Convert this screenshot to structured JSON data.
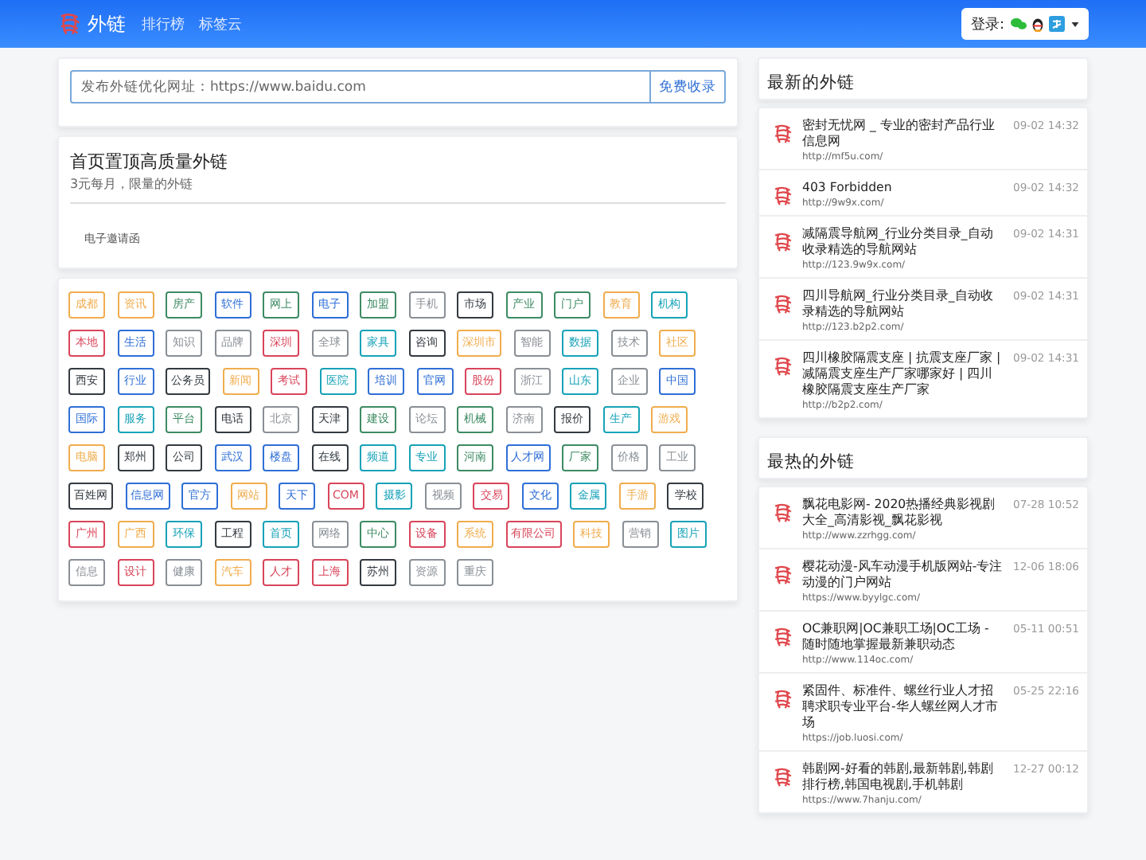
{
  "navbar": {
    "brand": "外链",
    "links": [
      {
        "label": "排行榜"
      },
      {
        "label": "标签云"
      }
    ],
    "login": {
      "label": "登录:"
    }
  },
  "submit": {
    "placeholder": "发布外链优化网址：https://www.baidu.com",
    "button": "免费收录"
  },
  "promo": {
    "title": "首页置顶高质量外链",
    "subtitle": "3元每月，限量的外链",
    "items": [
      "电子邀请函"
    ]
  },
  "tags": [
    {
      "label": "成都",
      "color": "#f0ad4e"
    },
    {
      "label": "资讯",
      "color": "#f0ad4e"
    },
    {
      "label": "房产",
      "color": "#3d8b63"
    },
    {
      "label": "软件",
      "color": "#2f6fd6"
    },
    {
      "label": "网上",
      "color": "#3d8b63"
    },
    {
      "label": "电子",
      "color": "#2f6fd6"
    },
    {
      "label": "加盟",
      "color": "#3d8b63"
    },
    {
      "label": "手机",
      "color": "#8a8f95"
    },
    {
      "label": "市场",
      "color": "#343a40"
    },
    {
      "label": "产业",
      "color": "#3d8b63"
    },
    {
      "label": "门户",
      "color": "#3d8b63"
    },
    {
      "label": "教育",
      "color": "#f0ad4e"
    },
    {
      "label": "机构",
      "color": "#17a2b8"
    },
    {
      "label": "本地",
      "color": "#d9455a"
    },
    {
      "label": "生活",
      "color": "#2f6fd6"
    },
    {
      "label": "知识",
      "color": "#8a8f95"
    },
    {
      "label": "品牌",
      "color": "#8a8f95"
    },
    {
      "label": "深圳",
      "color": "#d9455a"
    },
    {
      "label": "全球",
      "color": "#8a8f95"
    },
    {
      "label": "家具",
      "color": "#17a2b8"
    },
    {
      "label": "咨询",
      "color": "#343a40"
    },
    {
      "label": "深圳市",
      "color": "#f0ad4e"
    },
    {
      "label": "智能",
      "color": "#8a8f95"
    },
    {
      "label": "数据",
      "color": "#17a2b8"
    },
    {
      "label": "技术",
      "color": "#8a8f95"
    },
    {
      "label": "社区",
      "color": "#f0ad4e"
    },
    {
      "label": "西安",
      "color": "#343a40"
    },
    {
      "label": "行业",
      "color": "#2f6fd6"
    },
    {
      "label": "公务员",
      "color": "#343a40"
    },
    {
      "label": "新闻",
      "color": "#f0ad4e"
    },
    {
      "label": "考试",
      "color": "#d9455a"
    },
    {
      "label": "医院",
      "color": "#17a2b8"
    },
    {
      "label": "培训",
      "color": "#2f6fd6"
    },
    {
      "label": "官网",
      "color": "#2f6fd6"
    },
    {
      "label": "股份",
      "color": "#d9455a"
    },
    {
      "label": "浙江",
      "color": "#8a8f95"
    },
    {
      "label": "山东",
      "color": "#17a2b8"
    },
    {
      "label": "企业",
      "color": "#8a8f95"
    },
    {
      "label": "中国",
      "color": "#2f6fd6"
    },
    {
      "label": "国际",
      "color": "#2f6fd6"
    },
    {
      "label": "服务",
      "color": "#17a2b8"
    },
    {
      "label": "平台",
      "color": "#3d8b63"
    },
    {
      "label": "电话",
      "color": "#343a40"
    },
    {
      "label": "北京",
      "color": "#8a8f95"
    },
    {
      "label": "天津",
      "color": "#343a40"
    },
    {
      "label": "建设",
      "color": "#3d8b63"
    },
    {
      "label": "论坛",
      "color": "#8a8f95"
    },
    {
      "label": "机械",
      "color": "#3d8b63"
    },
    {
      "label": "济南",
      "color": "#8a8f95"
    },
    {
      "label": "报价",
      "color": "#343a40"
    },
    {
      "label": "生产",
      "color": "#17a2b8"
    },
    {
      "label": "游戏",
      "color": "#f0ad4e"
    },
    {
      "label": "电脑",
      "color": "#f0ad4e"
    },
    {
      "label": "郑州",
      "color": "#343a40"
    },
    {
      "label": "公司",
      "color": "#343a40"
    },
    {
      "label": "武汉",
      "color": "#2f6fd6"
    },
    {
      "label": "楼盘",
      "color": "#2f6fd6"
    },
    {
      "label": "在线",
      "color": "#343a40"
    },
    {
      "label": "频道",
      "color": "#17a2b8"
    },
    {
      "label": "专业",
      "color": "#17a2b8"
    },
    {
      "label": "河南",
      "color": "#3d8b63"
    },
    {
      "label": "人才网",
      "color": "#2f6fd6"
    },
    {
      "label": "厂家",
      "color": "#3d8b63"
    },
    {
      "label": "价格",
      "color": "#8a8f95"
    },
    {
      "label": "工业",
      "color": "#8a8f95"
    },
    {
      "label": "百姓网",
      "color": "#343a40"
    },
    {
      "label": "信息网",
      "color": "#2f6fd6"
    },
    {
      "label": "官方",
      "color": "#2f6fd6"
    },
    {
      "label": "网站",
      "color": "#f0ad4e"
    },
    {
      "label": "天下",
      "color": "#2f6fd6"
    },
    {
      "label": "COM",
      "color": "#d9455a"
    },
    {
      "label": "摄影",
      "color": "#17a2b8"
    },
    {
      "label": "视频",
      "color": "#8a8f95"
    },
    {
      "label": "交易",
      "color": "#d9455a"
    },
    {
      "label": "文化",
      "color": "#2f6fd6"
    },
    {
      "label": "金属",
      "color": "#17a2b8"
    },
    {
      "label": "手游",
      "color": "#f0ad4e"
    },
    {
      "label": "学校",
      "color": "#343a40"
    },
    {
      "label": "广州",
      "color": "#d9455a"
    },
    {
      "label": "广西",
      "color": "#f0ad4e"
    },
    {
      "label": "环保",
      "color": "#17a2b8"
    },
    {
      "label": "工程",
      "color": "#343a40"
    },
    {
      "label": "首页",
      "color": "#17a2b8"
    },
    {
      "label": "网络",
      "color": "#8a8f95"
    },
    {
      "label": "中心",
      "color": "#3d8b63"
    },
    {
      "label": "设备",
      "color": "#d9455a"
    },
    {
      "label": "系统",
      "color": "#f0ad4e"
    },
    {
      "label": "有限公司",
      "color": "#d9455a"
    },
    {
      "label": "科技",
      "color": "#f0ad4e"
    },
    {
      "label": "营销",
      "color": "#8a8f95"
    },
    {
      "label": "图片",
      "color": "#17a2b8"
    },
    {
      "label": "信息",
      "color": "#8a8f95"
    },
    {
      "label": "设计",
      "color": "#d9455a"
    },
    {
      "label": "健康",
      "color": "#8a8f95"
    },
    {
      "label": "汽车",
      "color": "#f0ad4e"
    },
    {
      "label": "人才",
      "color": "#d9455a"
    },
    {
      "label": "上海",
      "color": "#d9455a"
    },
    {
      "label": "苏州",
      "color": "#343a40"
    },
    {
      "label": "资源",
      "color": "#8a8f95"
    },
    {
      "label": "重庆",
      "color": "#8a8f95"
    }
  ],
  "sections": [
    {
      "title": "最新的外链",
      "items": [
        {
          "title": "密封无忧网 _ 专业的密封产品行业信息网",
          "url": "http://mf5u.com/",
          "time": "09-02 14:32"
        },
        {
          "title": "403 Forbidden",
          "url": "http://9w9x.com/",
          "time": "09-02 14:32"
        },
        {
          "title": "减隔震导航网_行业分类目录_自动收录精选的导航网站",
          "url": "http://123.9w9x.com/",
          "time": "09-02 14:31"
        },
        {
          "title": "四川导航网_行业分类目录_自动收录精选的导航网站",
          "url": "http://123.b2p2.com/",
          "time": "09-02 14:31"
        },
        {
          "title": "四川橡胶隔震支座 | 抗震支座厂家 | 减隔震支座生产厂家哪家好 | 四川橡胶隔震支座生产厂家",
          "url": "http://b2p2.com/",
          "time": "09-02 14:31"
        }
      ]
    },
    {
      "title": "最热的外链",
      "items": [
        {
          "title": "飘花电影网- 2020热播经典影视剧大全_高清影视_飘花影视",
          "url": "http://www.zzrhgg.com/",
          "time": "07-28 10:52"
        },
        {
          "title": "樱花动漫-风车动漫手机版网站-专注动漫的门户网站",
          "url": "https://www.byylgc.com/",
          "time": "12-06 18:06"
        },
        {
          "title": "OC兼职网|OC兼职工场|OC工场 - 随时随地掌握最新兼职动态",
          "url": "http://www.114oc.com/",
          "time": "05-11 00:51"
        },
        {
          "title": "紧固件、标准件、螺丝行业人才招聘求职专业平台-华人螺丝网人才市场",
          "url": "https://job.luosi.com/",
          "time": "05-25 22:16"
        },
        {
          "title": "韩剧网-好看的韩剧,最新韩剧,韩剧排行榜,韩国电视剧,手机韩剧",
          "url": "https://www.7hanju.com/",
          "time": "12-27 00:12"
        }
      ]
    }
  ]
}
